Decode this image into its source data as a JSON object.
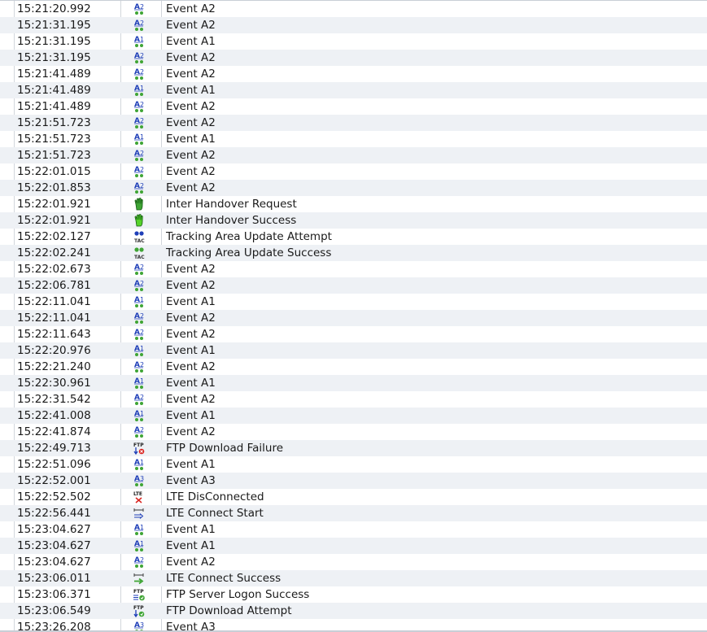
{
  "colors": {
    "event_text": "#1a1a1a",
    "icon_green": "#3fa535",
    "icon_blue": "#1f3fb8",
    "icon_red": "#d9231f"
  },
  "rows": [
    {
      "time": "15:21:20.992",
      "icon": "event-a2-icon",
      "event": "Event A2"
    },
    {
      "time": "15:21:31.195",
      "icon": "event-a2-icon",
      "event": "Event A2"
    },
    {
      "time": "15:21:31.195",
      "icon": "event-a1-icon",
      "event": "Event A1"
    },
    {
      "time": "15:21:31.195",
      "icon": "event-a2-icon",
      "event": "Event A2"
    },
    {
      "time": "15:21:41.489",
      "icon": "event-a2-icon",
      "event": "Event A2"
    },
    {
      "time": "15:21:41.489",
      "icon": "event-a1-icon",
      "event": "Event A1"
    },
    {
      "time": "15:21:41.489",
      "icon": "event-a2-icon",
      "event": "Event A2"
    },
    {
      "time": "15:21:51.723",
      "icon": "event-a2-icon",
      "event": "Event A2"
    },
    {
      "time": "15:21:51.723",
      "icon": "event-a1-icon",
      "event": "Event A1"
    },
    {
      "time": "15:21:51.723",
      "icon": "event-a2-icon",
      "event": "Event A2"
    },
    {
      "time": "15:22:01.015",
      "icon": "event-a2-icon",
      "event": "Event A2"
    },
    {
      "time": "15:22:01.853",
      "icon": "event-a2-icon",
      "event": "Event A2"
    },
    {
      "time": "15:22:01.921",
      "icon": "hand-request-icon",
      "event": "Inter Handover Request"
    },
    {
      "time": "15:22:01.921",
      "icon": "hand-success-icon",
      "event": "Inter Handover Success"
    },
    {
      "time": "15:22:02.127",
      "icon": "tac-attempt-icon",
      "event": "Tracking Area Update Attempt"
    },
    {
      "time": "15:22:02.241",
      "icon": "tac-success-icon",
      "event": "Tracking Area Update Success"
    },
    {
      "time": "15:22:02.673",
      "icon": "event-a2-icon",
      "event": "Event A2"
    },
    {
      "time": "15:22:06.781",
      "icon": "event-a2-icon",
      "event": "Event A2"
    },
    {
      "time": "15:22:11.041",
      "icon": "event-a1-icon",
      "event": "Event A1"
    },
    {
      "time": "15:22:11.041",
      "icon": "event-a2-icon",
      "event": "Event A2"
    },
    {
      "time": "15:22:11.643",
      "icon": "event-a2-icon",
      "event": "Event A2"
    },
    {
      "time": "15:22:20.976",
      "icon": "event-a1-icon",
      "event": "Event A1"
    },
    {
      "time": "15:22:21.240",
      "icon": "event-a2-icon",
      "event": "Event A2"
    },
    {
      "time": "15:22:30.961",
      "icon": "event-a1-icon",
      "event": "Event A1"
    },
    {
      "time": "15:22:31.542",
      "icon": "event-a2-icon",
      "event": "Event A2"
    },
    {
      "time": "15:22:41.008",
      "icon": "event-a1-icon",
      "event": "Event A1"
    },
    {
      "time": "15:22:41.874",
      "icon": "event-a2-icon",
      "event": "Event A2"
    },
    {
      "time": "15:22:49.713",
      "icon": "ftp-download-failure-icon",
      "event": "FTP Download Failure"
    },
    {
      "time": "15:22:51.096",
      "icon": "event-a1-icon",
      "event": "Event A1"
    },
    {
      "time": "15:22:52.001",
      "icon": "event-a3-icon",
      "event": "Event A3"
    },
    {
      "time": "15:22:52.502",
      "icon": "lte-disconnected-icon",
      "event": "LTE DisConnected"
    },
    {
      "time": "15:22:56.441",
      "icon": "lte-connect-start-icon",
      "event": "LTE Connect Start"
    },
    {
      "time": "15:23:04.627",
      "icon": "event-a1-icon",
      "event": "Event A1"
    },
    {
      "time": "15:23:04.627",
      "icon": "event-a1-icon",
      "event": "Event A1"
    },
    {
      "time": "15:23:04.627",
      "icon": "event-a2-icon",
      "event": "Event A2"
    },
    {
      "time": "15:23:06.011",
      "icon": "lte-connect-success-icon",
      "event": "LTE Connect Success"
    },
    {
      "time": "15:23:06.371",
      "icon": "ftp-logon-success-icon",
      "event": "FTP Server Logon Success"
    },
    {
      "time": "15:23:06.549",
      "icon": "ftp-download-attempt-icon",
      "event": "FTP Download Attempt"
    },
    {
      "time": "15:23:26.208",
      "icon": "event-a3-icon",
      "event": "Event A3"
    }
  ]
}
